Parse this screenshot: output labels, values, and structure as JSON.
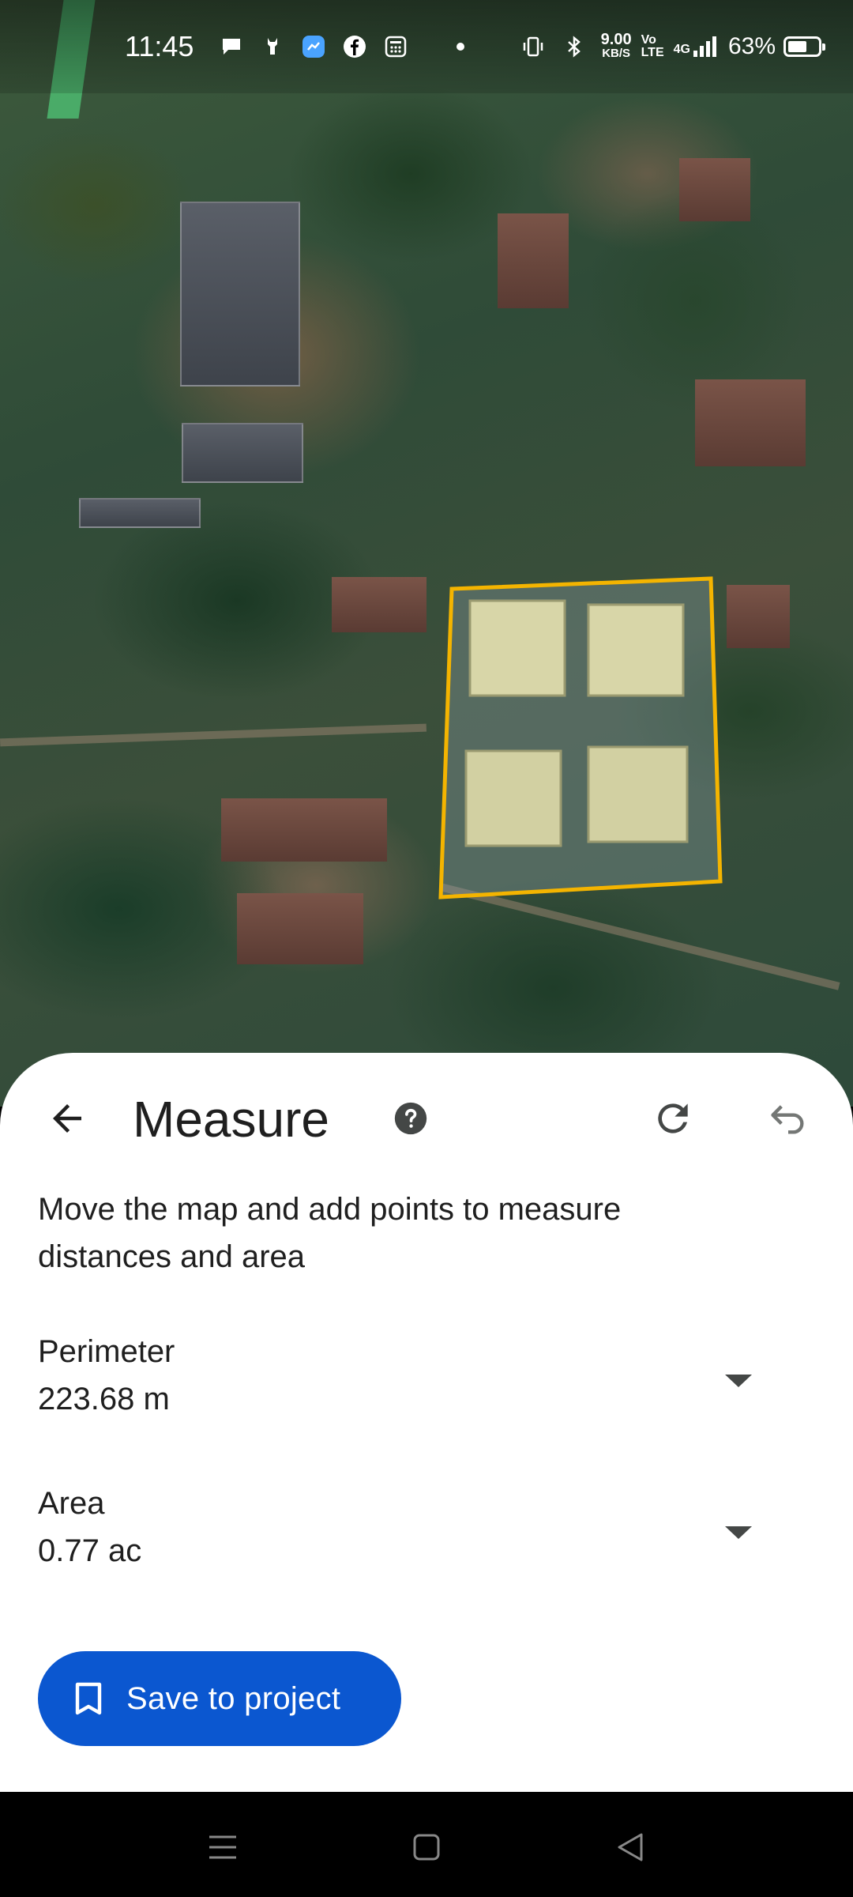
{
  "status_bar": {
    "time": "11:45",
    "net_speed_value": "9.00",
    "net_speed_unit": "KB/S",
    "volte_top": "Vo",
    "volte_bottom": "LTE",
    "network_type": "4G",
    "battery_percent": "63%",
    "battery_level": 0.63,
    "notification_icons": [
      "chat-bubble-icon",
      "notification-app-icon",
      "messenger-app-icon",
      "facebook-icon",
      "calculator-icon",
      "dot-icon"
    ]
  },
  "map": {
    "outline_color": "#f4b400"
  },
  "sheet": {
    "title": "Measure",
    "instructions": "Move the map and add points to measure distances and area",
    "perimeter": {
      "label": "Perimeter",
      "value": "223.68 m"
    },
    "area": {
      "label": "Area",
      "value": "0.77 ac"
    },
    "save_button_label": "Save to project",
    "accent_color": "#0b57d0"
  }
}
